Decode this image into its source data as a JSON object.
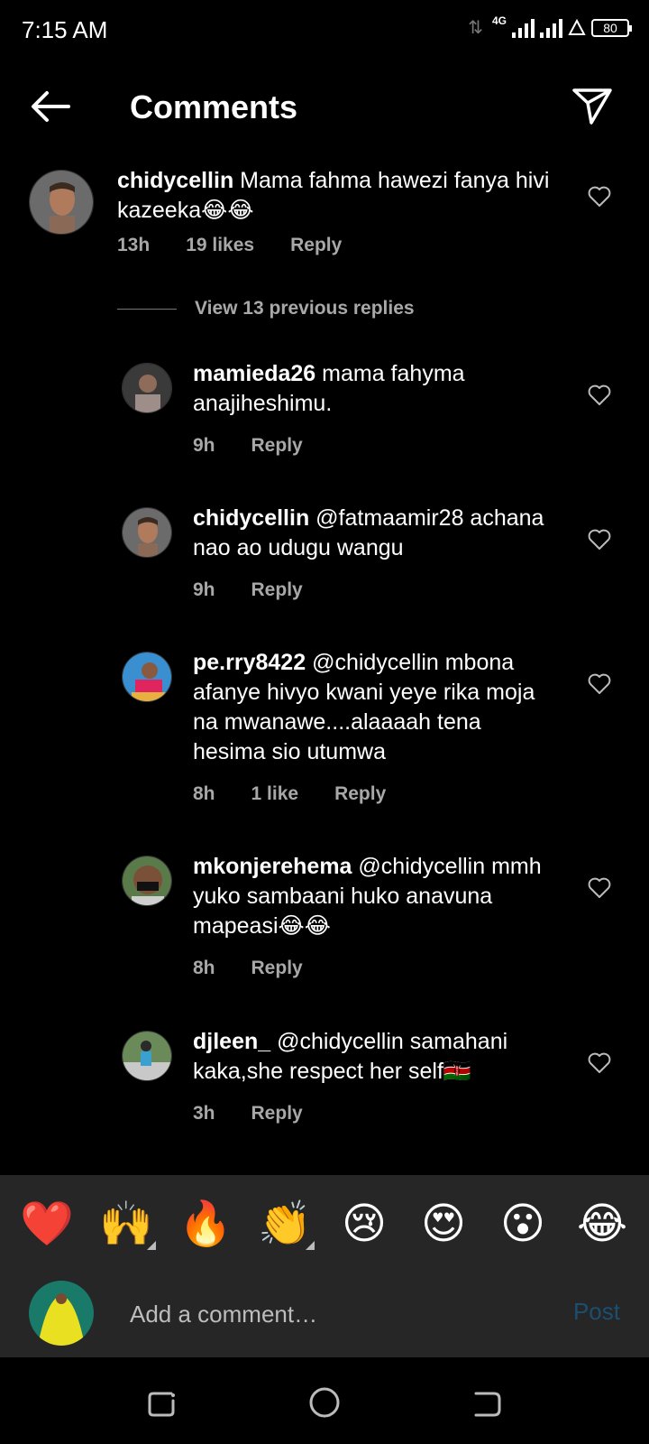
{
  "status_bar": {
    "time": "7:15 AM",
    "network": "4G",
    "battery": "80"
  },
  "header": {
    "title": "Comments"
  },
  "main_comment": {
    "username": "chidycellin",
    "text": "Mama fahma hawezi fanya hivi kazeeka😂😂",
    "time": "13h",
    "likes": "19 likes",
    "reply_label": "Reply"
  },
  "view_replies": "View 13 previous replies",
  "replies": [
    {
      "username": "mamieda26",
      "text": "mama fahyma anajiheshimu.",
      "time": "9h",
      "likes": "",
      "reply_label": "Reply"
    },
    {
      "username": "chidycellin",
      "text": "@fatmaamir28 achana nao ao udugu wangu",
      "time": "9h",
      "likes": "",
      "reply_label": "Reply"
    },
    {
      "username": "pe.rry8422",
      "text": "@chidycellin mbona afanye hivyo kwani  yeye rika moja na mwanawe....alaaaah tena hesima sio utumwa",
      "time": "8h",
      "likes": "1 like",
      "reply_label": "Reply"
    },
    {
      "username": "mkonjerehema",
      "text": "@chidycellin mmh yuko sambaani huko anavuna mapeasi😂😂",
      "time": "8h",
      "likes": "",
      "reply_label": "Reply"
    },
    {
      "username": "djleen_",
      "text": "@chidycellin samahani kaka,she respect her self🇰🇪",
      "time": "3h",
      "likes": "",
      "reply_label": "Reply"
    }
  ],
  "emoji_bar": [
    "❤️",
    "🙌",
    "🔥",
    "👏",
    "😢",
    "😍",
    "😮",
    "😂"
  ],
  "comment_input": {
    "placeholder": "Add a comment…",
    "post_label": "Post"
  },
  "colors": {
    "background": "#000000",
    "secondary_text": "#a8a8a8",
    "panel": "#262626",
    "post_disabled": "#1c4e70"
  }
}
